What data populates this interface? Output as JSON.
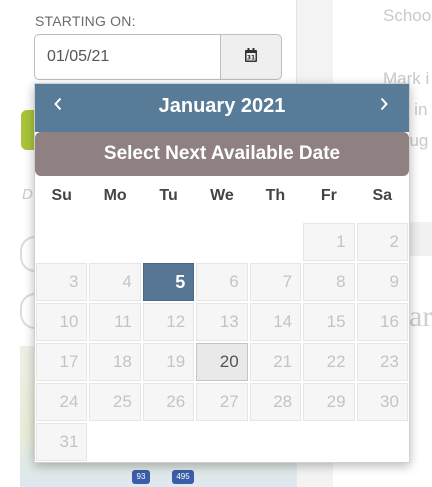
{
  "form": {
    "label": "STARTING ON:",
    "date_value": "01/05/21",
    "calendar_button_icon": "calendar-icon"
  },
  "background": {
    "text_schoo": "Schoo",
    "text_mark": "Mark i",
    "text_line2": "o in",
    "text_line3": "oug",
    "big_letters": "ar",
    "ghost_d": "D",
    "shield_1": "93",
    "shield_2": "495"
  },
  "datepicker": {
    "month_title": "January 2021",
    "prev_icon": "chevron-left-icon",
    "next_icon": "chevron-right-icon",
    "next_available_label": "Select Next Available Date",
    "weekdays": [
      "Su",
      "Mo",
      "Tu",
      "We",
      "Th",
      "Fr",
      "Sa"
    ],
    "weeks": [
      [
        "",
        "",
        "",
        "",
        "",
        "1",
        "2"
      ],
      [
        "3",
        "4",
        "5",
        "6",
        "7",
        "8",
        "9"
      ],
      [
        "10",
        "11",
        "12",
        "13",
        "14",
        "15",
        "16"
      ],
      [
        "17",
        "18",
        "19",
        "20",
        "21",
        "22",
        "23"
      ],
      [
        "24",
        "25",
        "26",
        "27",
        "28",
        "29",
        "30"
      ],
      [
        "31",
        "",
        "",
        "",
        "",
        "",
        ""
      ]
    ],
    "selected_day": "5",
    "today_day": "20",
    "colors": {
      "header": "#587c98",
      "next_button": "#8f8181",
      "selected": "#567694"
    }
  }
}
